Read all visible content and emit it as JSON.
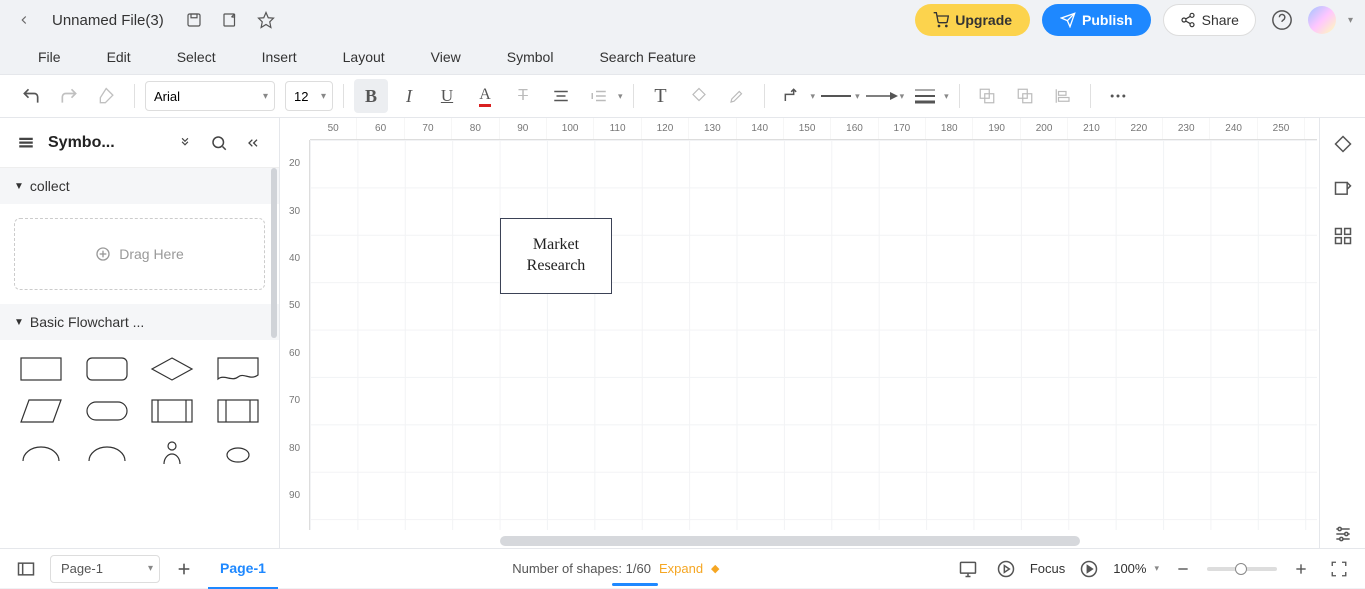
{
  "title": "Unnamed File(3)",
  "header_buttons": {
    "upgrade": "Upgrade",
    "publish": "Publish",
    "share": "Share"
  },
  "menus": [
    "File",
    "Edit",
    "Select",
    "Insert",
    "Layout",
    "View",
    "Symbol",
    "Search Feature"
  ],
  "toolbar": {
    "font": "Arial",
    "size": "12"
  },
  "left_panel": {
    "title": "Symbo...",
    "sections": {
      "collect": "collect",
      "drag": "Drag Here",
      "flowchart": "Basic Flowchart ..."
    }
  },
  "canvas": {
    "h_ticks": [
      "50",
      "60",
      "70",
      "80",
      "90",
      "100",
      "110",
      "120",
      "130",
      "140",
      "150",
      "160",
      "170",
      "180",
      "190",
      "200",
      "210",
      "220",
      "230",
      "240",
      "250"
    ],
    "v_ticks": [
      "20",
      "30",
      "40",
      "50",
      "60",
      "70",
      "80",
      "90"
    ],
    "shape_text": "Market\nResearch"
  },
  "status": {
    "page_select": "Page-1",
    "active_tab": "Page-1",
    "shapes_label": "Number of shapes: 1/60",
    "expand": "Expand",
    "focus": "Focus",
    "zoom": "100%"
  }
}
